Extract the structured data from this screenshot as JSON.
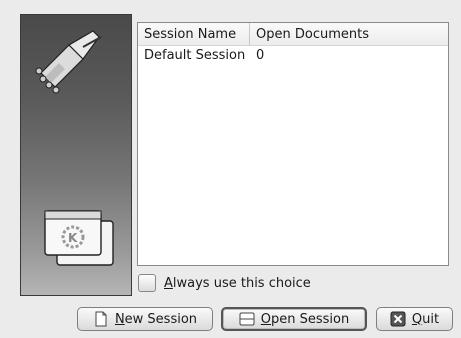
{
  "sidebar": {
    "logo_icon": "broom-icon",
    "badge_icon": "kde-window-icon"
  },
  "list": {
    "columns": [
      "Session Name",
      "Open Documents"
    ],
    "rows": [
      {
        "name": "Default Session",
        "docs": "0"
      }
    ]
  },
  "checkbox": {
    "label_first": "A",
    "label_rest": "lways use this choice",
    "checked": false
  },
  "buttons": {
    "new_session": {
      "icon": "new-document-icon",
      "mnemonic": "N",
      "rest": "ew Session"
    },
    "open_session": {
      "icon": "window-icon",
      "mnemonic": "O",
      "rest": "pen Session"
    },
    "quit": {
      "icon": "close-icon",
      "mnemonic": "Q",
      "rest": "uit"
    }
  }
}
